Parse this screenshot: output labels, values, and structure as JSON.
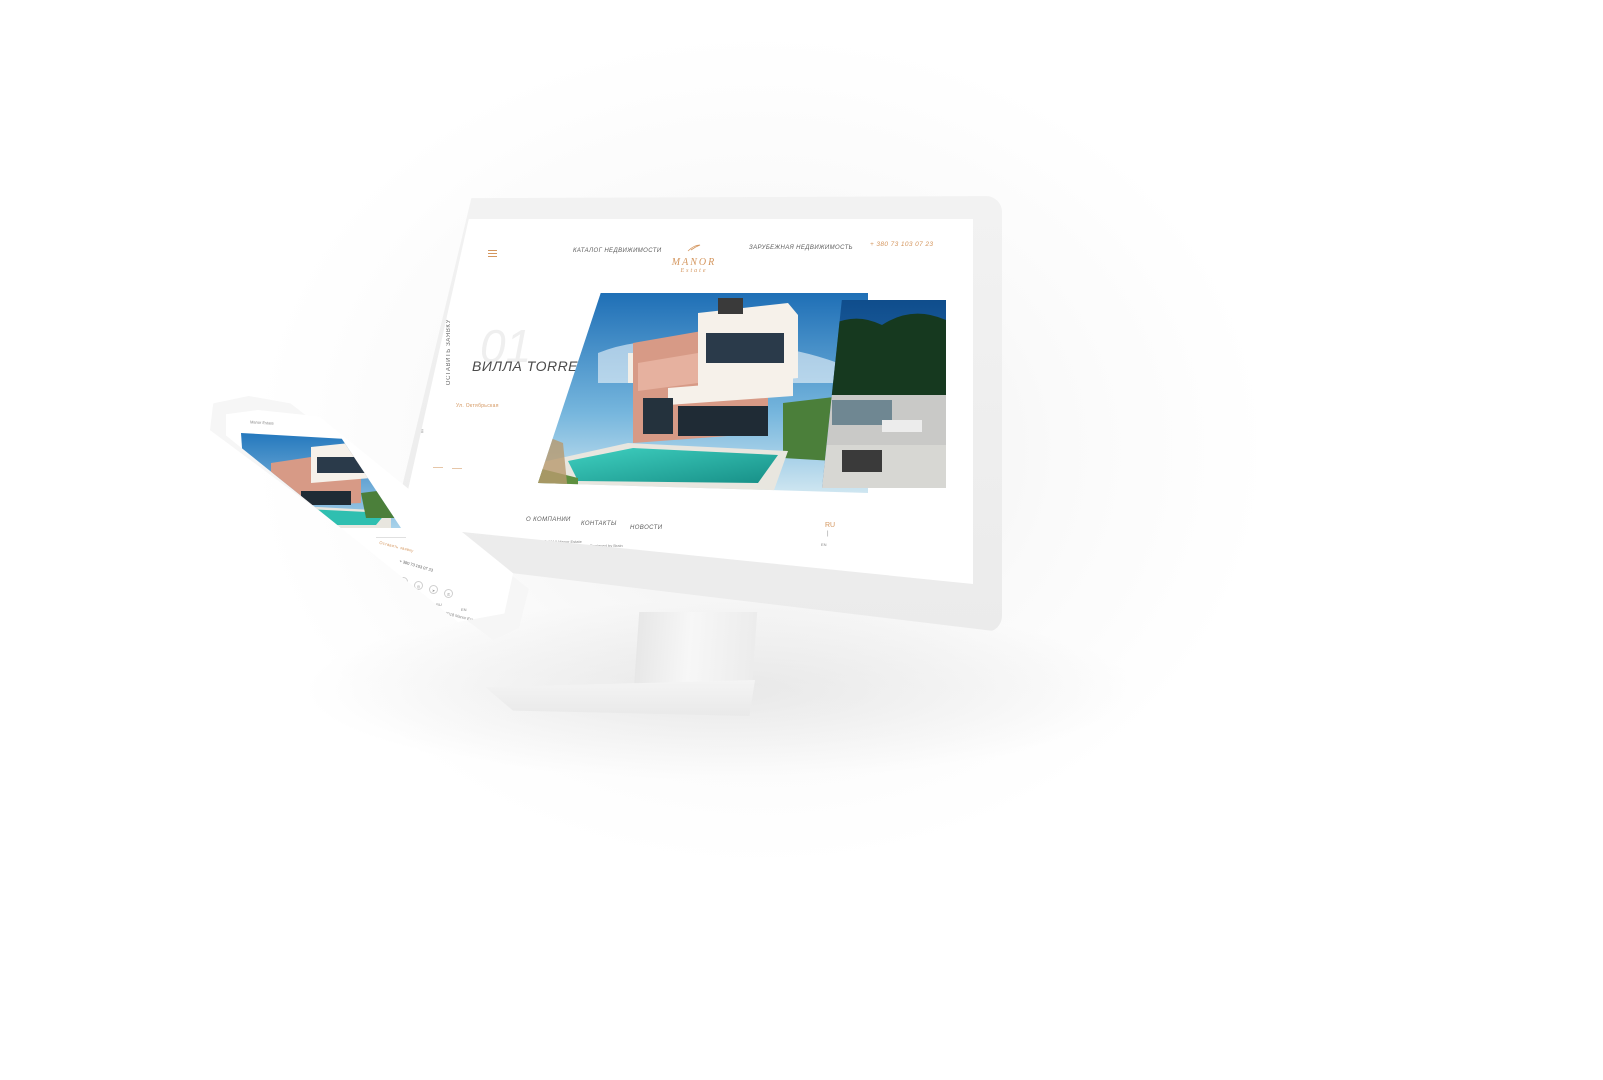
{
  "desktop": {
    "nav": {
      "catalog": "Каталог недвижимости",
      "overseas": "Зарубежная недвижимость",
      "phone": "+ 380 73 103 07 23"
    },
    "logo": {
      "main": "MANOR",
      "sub": "Estate"
    },
    "hero": {
      "number": "01",
      "title": "ВИЛЛА TORREVIEJA",
      "side_label": "оставить заявку",
      "location": "Ул. Октябрьская"
    },
    "footer": {
      "links": [
        "О компании",
        "Контакты",
        "Новости"
      ],
      "copyright": "© 2018 Manor Estate",
      "developer": "Designed by Brain"
    },
    "lang": {
      "active": "RU",
      "separator": "|",
      "other": "EN"
    }
  },
  "mobile": {
    "header": "Manor Estate",
    "cta": "Оставить заявку",
    "phone": "+ 380 73 103 07 23",
    "lang_ru": "RU",
    "lang_en": "EN",
    "copyright": "© 2018 Manor Estate",
    "social_icons": [
      "facebook-icon",
      "instagram-icon",
      "telegram-icon",
      "viber-icon"
    ]
  },
  "colors": {
    "accent": "#d4965e",
    "text": "#4a4a4a",
    "bezel": "#eeeeee"
  }
}
